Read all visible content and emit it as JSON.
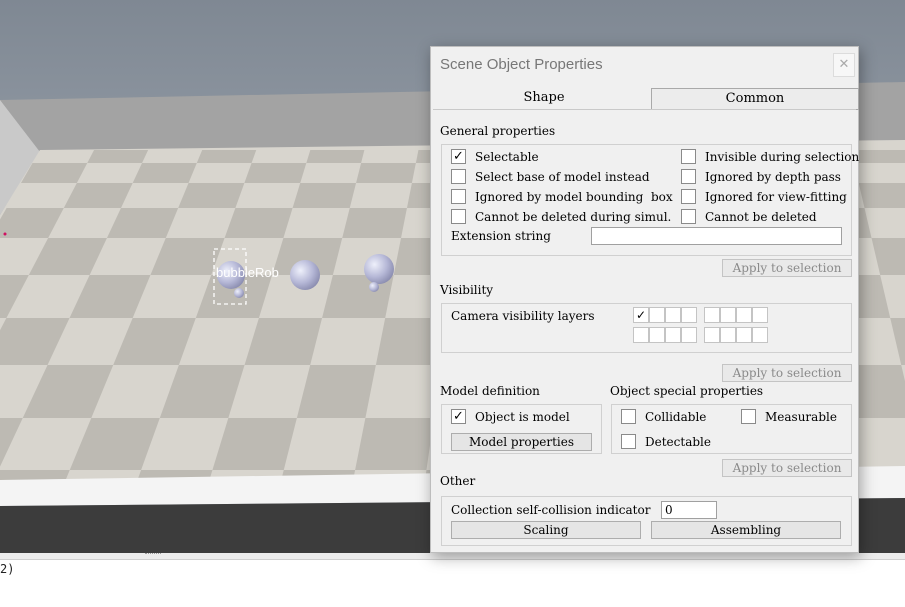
{
  "scene": {
    "robot_label": "bubbleRob",
    "colors": {
      "sky": "#8f98a3",
      "floor_light": "#d9d6cf",
      "floor_dark": "#bdbab3",
      "wall": "#9e9e9e",
      "sphere": "#b8b9d8"
    }
  },
  "console": {
    "text": "2)"
  },
  "dialog": {
    "title": "Scene Object Properties",
    "close_icon": "close-icon",
    "tabs": [
      {
        "label": "Shape"
      },
      {
        "label": "Common"
      }
    ],
    "general": {
      "heading": "General properties",
      "options": [
        {
          "label": "Selectable",
          "checked": true
        },
        {
          "label": "Invisible during selection",
          "checked": false
        },
        {
          "label": "Select base of model instead",
          "checked": false
        },
        {
          "label": "Ignored by depth pass",
          "checked": false
        },
        {
          "label": "Ignored by model bounding  box",
          "checked": false
        },
        {
          "label": "Ignored for view-fitting",
          "checked": false
        },
        {
          "label": "Cannot be deleted during simul.",
          "checked": false
        },
        {
          "label": "Cannot be deleted",
          "checked": false
        }
      ],
      "extension_label": "Extension string",
      "extension_value": "",
      "apply_label": "Apply to selection"
    },
    "visibility": {
      "heading": "Visibility",
      "layers_label": "Camera visibility layers",
      "layers": [
        true,
        false,
        false,
        false,
        false,
        false,
        false,
        false,
        false,
        false,
        false,
        false,
        false,
        false,
        false,
        false
      ],
      "apply_label": "Apply to selection"
    },
    "model": {
      "heading": "Model definition",
      "object_is_model_label": "Object is model",
      "object_is_model_checked": true,
      "properties_button": "Model properties"
    },
    "special": {
      "heading": "Object special properties",
      "collidable_label": "Collidable",
      "measurable_label": "Measurable",
      "detectable_label": "Detectable",
      "apply_label": "Apply to selection"
    },
    "other": {
      "heading": "Other",
      "collision_label": "Collection self-collision indicator",
      "collision_value": "0",
      "scaling_button": "Scaling",
      "assembling_button": "Assembling"
    }
  }
}
